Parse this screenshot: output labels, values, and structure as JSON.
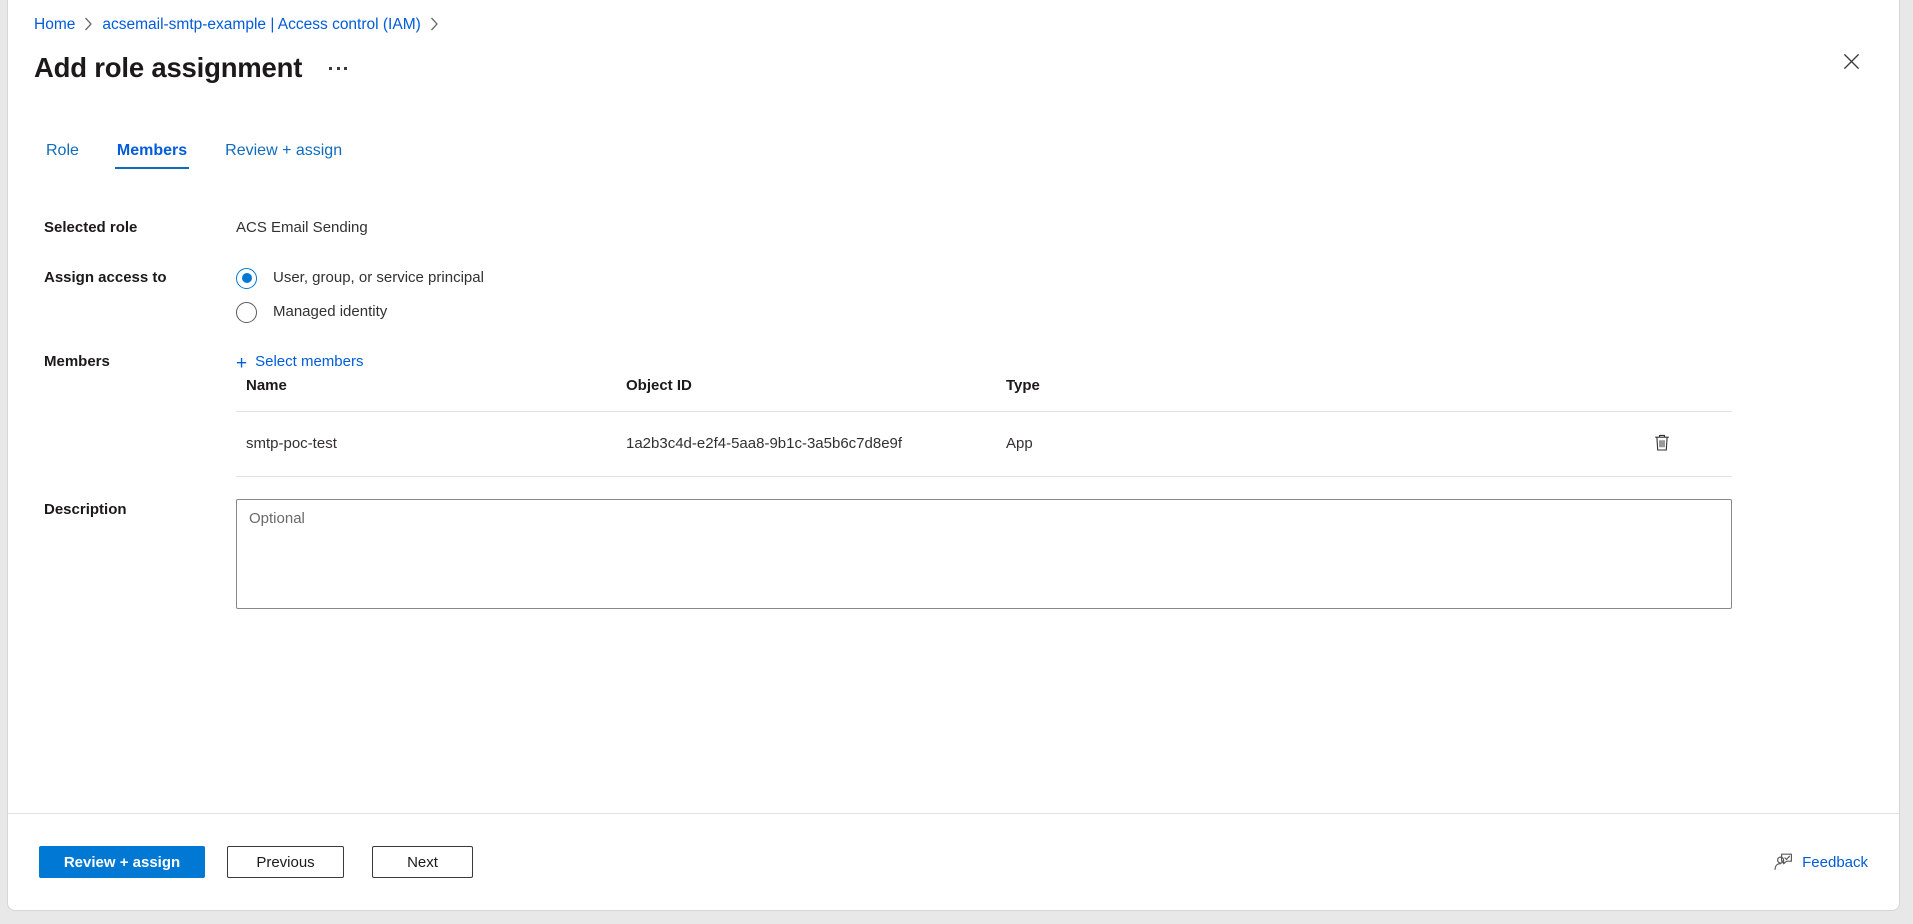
{
  "breadcrumb": {
    "items": [
      {
        "label": "Home"
      },
      {
        "label": "acsemail-smtp-example | Access control (IAM)"
      }
    ]
  },
  "header": {
    "title": "Add role assignment",
    "more_label": "More",
    "close_label": "Close",
    "icons": {
      "ellipsis": "ellipsis-icon",
      "close": "close-icon"
    }
  },
  "tabs": [
    {
      "id": "role",
      "label": "Role",
      "active": false
    },
    {
      "id": "members",
      "label": "Members",
      "active": true
    },
    {
      "id": "review",
      "label": "Review + assign",
      "active": false
    }
  ],
  "form": {
    "selected_role": {
      "label": "Selected role",
      "value": "ACS Email Sending"
    },
    "assign_access_to": {
      "label": "Assign access to",
      "options": [
        {
          "id": "user-group-sp",
          "label": "User, group, or service principal",
          "checked": true
        },
        {
          "id": "managed-identity",
          "label": "Managed identity",
          "checked": false
        }
      ]
    },
    "members": {
      "label": "Members",
      "select_members_label": "Select members",
      "plus_glyph": "+",
      "table": {
        "columns": [
          "Name",
          "Object ID",
          "Type",
          ""
        ],
        "rows": [
          {
            "name": "smtp-poc-test",
            "object_id": "1a2b3c4d-e2f4-5aa8-9b1c-3a5b6c7d8e9f",
            "type": "App",
            "delete_label": "Delete",
            "delete_icon": "trash-icon"
          }
        ]
      }
    },
    "description": {
      "label": "Description",
      "placeholder": "Optional",
      "value": ""
    }
  },
  "footer": {
    "review_assign_label": "Review + assign",
    "previous_label": "Previous",
    "next_label": "Next",
    "feedback_label": "Feedback",
    "feedback_icon": "person-feedback-icon"
  },
  "colors": {
    "accent": "#0078d4",
    "link": "#015cda",
    "tab_active": "#0f6cbd",
    "text": "#323130",
    "heading": "#1b1a19",
    "border": "#e1dfdd",
    "input_border": "#8a8886"
  }
}
